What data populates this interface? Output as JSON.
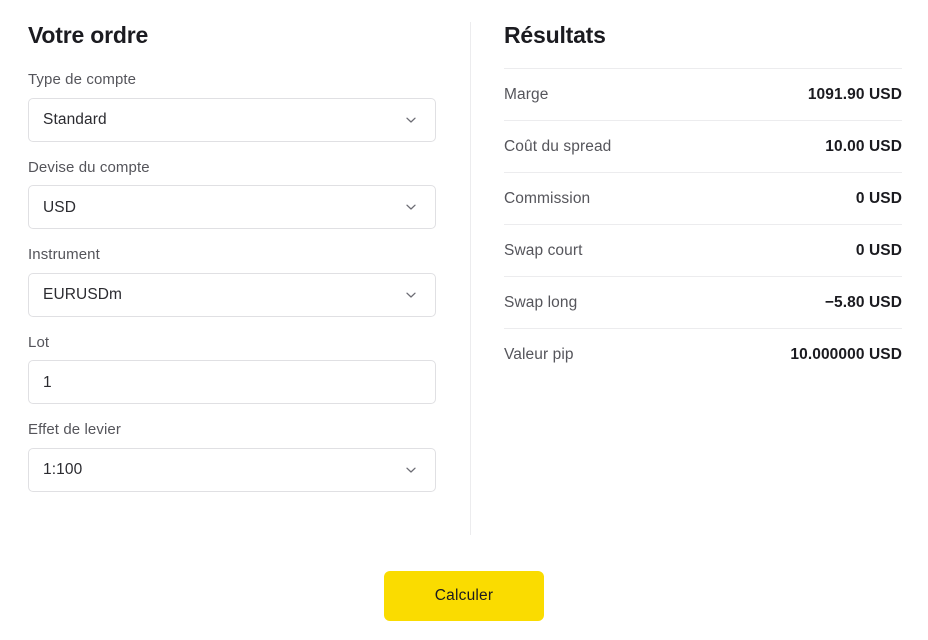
{
  "order": {
    "title": "Votre ordre",
    "fields": [
      {
        "label": "Type de compte",
        "value": "Standard",
        "control": "select",
        "name": "account-type"
      },
      {
        "label": "Devise du compte",
        "value": "USD",
        "control": "select",
        "name": "account-currency"
      },
      {
        "label": "Instrument",
        "value": "EURUSDm",
        "control": "select",
        "name": "instrument"
      },
      {
        "label": "Lot",
        "value": "1",
        "control": "text",
        "name": "lot"
      },
      {
        "label": "Effet de levier",
        "value": "1:100",
        "control": "select",
        "name": "leverage"
      }
    ]
  },
  "results": {
    "title": "Résultats",
    "rows": [
      {
        "label": "Marge",
        "value": "1091.90 USD"
      },
      {
        "label": "Coût du spread",
        "value": "10.00 USD"
      },
      {
        "label": "Commission",
        "value": "0 USD"
      },
      {
        "label": "Swap court",
        "value": "0 USD"
      },
      {
        "label": "Swap long",
        "value": "−5.80 USD"
      },
      {
        "label": "Valeur pip",
        "value": "10.000000 USD"
      }
    ]
  },
  "actions": {
    "submit_label": "Calculer"
  },
  "icons": {
    "chevron": "chevron-down-icon"
  },
  "colors": {
    "accent": "#fadc00",
    "border": "#e0e0e3",
    "divider": "#ececee",
    "label_text": "#55555b",
    "value_text": "#1b1b20"
  }
}
